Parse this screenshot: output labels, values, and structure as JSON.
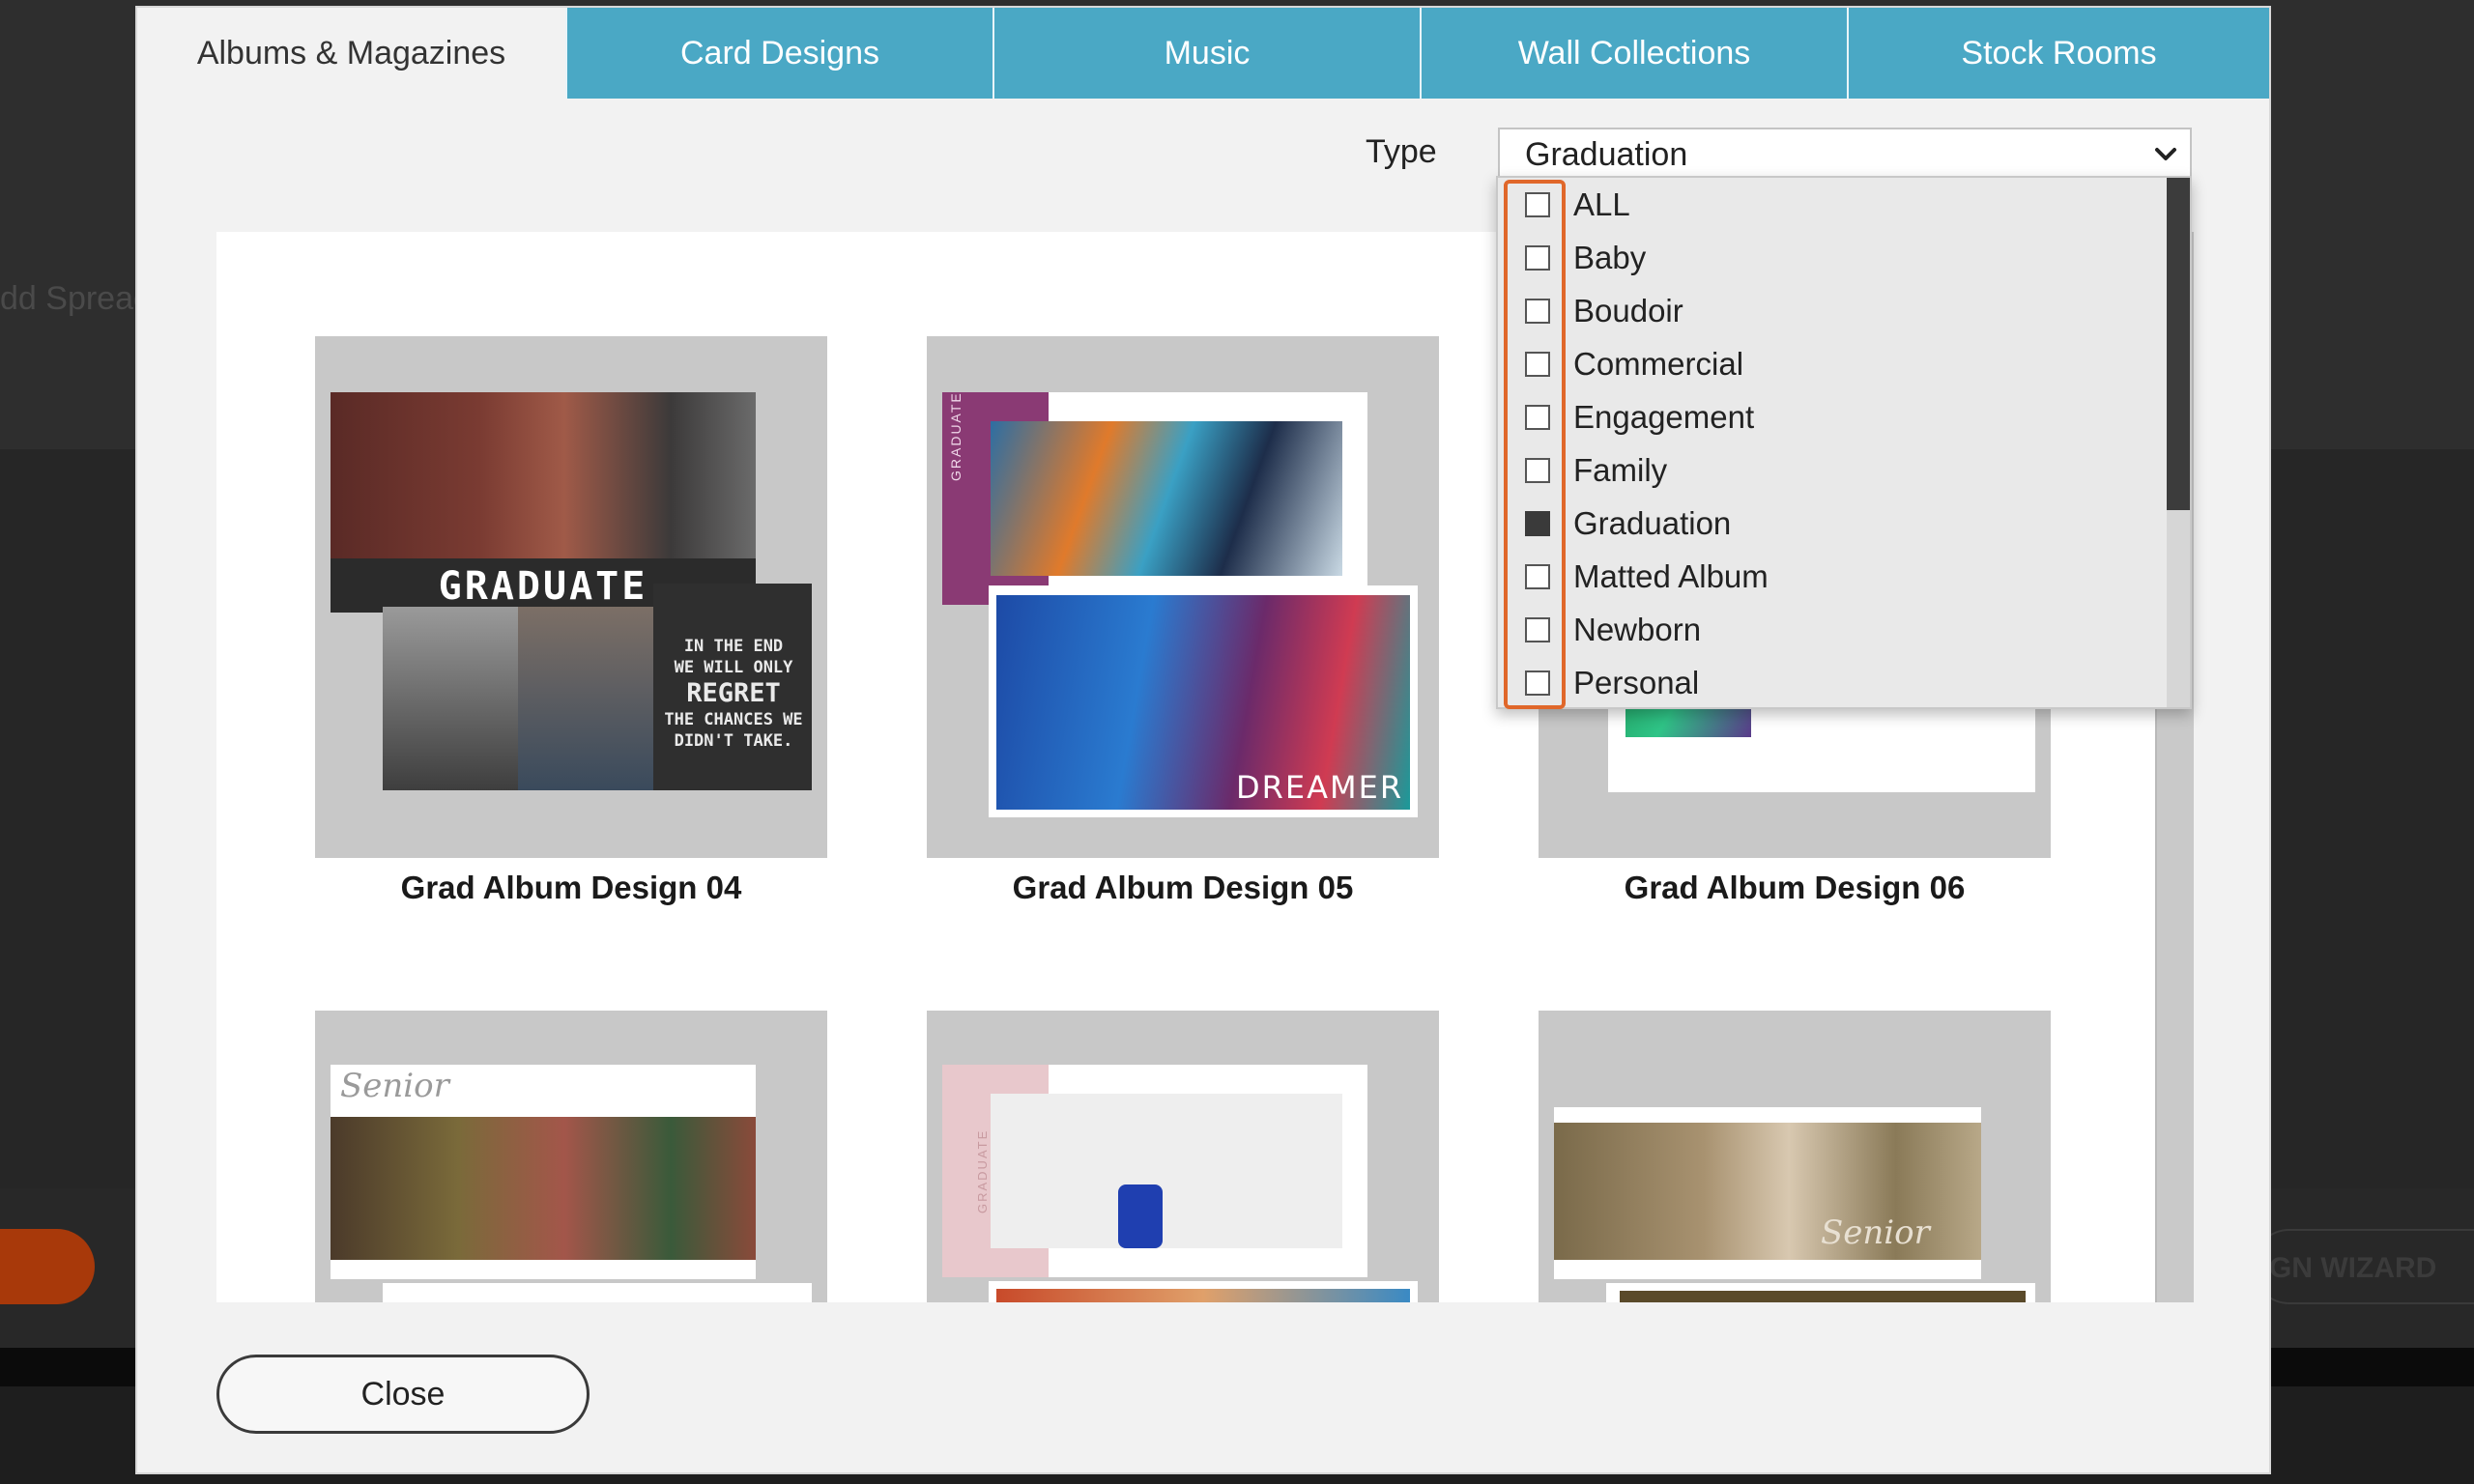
{
  "background": {
    "add_spread_label": "dd Spread",
    "wizard_label": "GN WIZARD"
  },
  "tabs": [
    {
      "label": "Albums & Magazines",
      "active": true
    },
    {
      "label": "Card Designs",
      "active": false
    },
    {
      "label": "Music",
      "active": false
    },
    {
      "label": "Wall Collections",
      "active": false
    },
    {
      "label": "Stock Rooms",
      "active": false
    }
  ],
  "filter": {
    "type_label": "Type",
    "selected": "Graduation",
    "options": [
      {
        "label": "ALL",
        "checked": false
      },
      {
        "label": "Baby",
        "checked": false
      },
      {
        "label": "Boudoir",
        "checked": false
      },
      {
        "label": "Commercial",
        "checked": false
      },
      {
        "label": "Engagement",
        "checked": false
      },
      {
        "label": "Family",
        "checked": false
      },
      {
        "label": "Graduation",
        "checked": true
      },
      {
        "label": "Matted Album",
        "checked": false
      },
      {
        "label": "Newborn",
        "checked": false
      },
      {
        "label": "Personal",
        "checked": false
      }
    ]
  },
  "designs": [
    {
      "name": "Grad Album Design 04",
      "thumb_text": [
        "GRADUATE",
        "IN THE END",
        "WE WILL ONLY",
        "REGRET",
        "THE CHANCES WE",
        "DIDN'T TAKE."
      ]
    },
    {
      "name": "Grad Album Design 05",
      "thumb_text": [
        "GRADUATE",
        "DREAMER"
      ]
    },
    {
      "name": "Grad Album Design 06",
      "thumb_text": []
    },
    {
      "name": "",
      "thumb_text": [
        "Senior"
      ]
    },
    {
      "name": "",
      "thumb_text": [
        "GRADUATE"
      ]
    },
    {
      "name": "",
      "thumb_text": [
        "Senior"
      ]
    }
  ],
  "actions": {
    "close_label": "Close"
  },
  "colors": {
    "tab_bg": "#4aa8c5",
    "highlight": "#e0672a",
    "modal_bg": "#f2f2f2"
  }
}
